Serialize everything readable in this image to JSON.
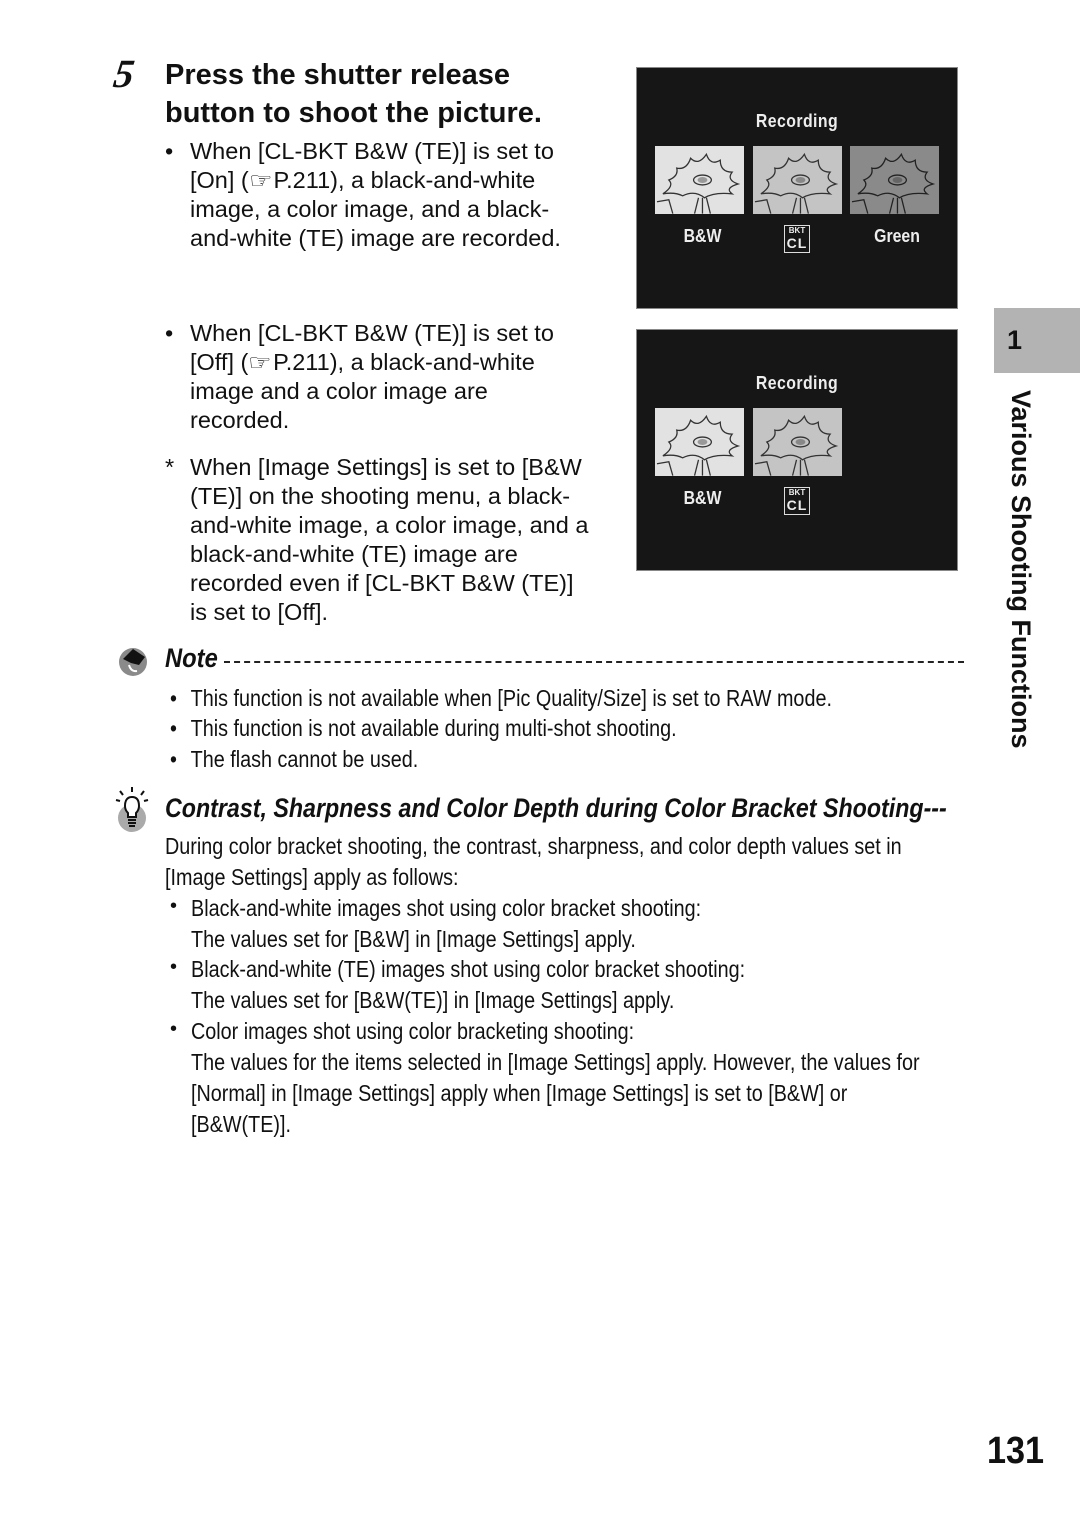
{
  "step": {
    "number": "5",
    "title_line1": "Press the shutter release",
    "title_line2": "button to shoot the picture."
  },
  "bullets": [
    {
      "mark": "•",
      "lines": [
        "When [CL-BKT B&W (TE)] is set to",
        "[On] (",
        "P.211), a black-and-white",
        "image, a color image, and a black-",
        "and-white (TE) image are recorded."
      ]
    },
    {
      "mark": "•",
      "lines": [
        "When [CL-BKT B&W (TE)] is set to",
        "[Off] (",
        "P.211), a black-and-white",
        "image and a color image are",
        "recorded."
      ]
    },
    {
      "mark": "*",
      "lines": [
        "When [Image Settings] is set to [B&W",
        "(TE)] on the shooting menu, a black-",
        "and-white image, a color image, and a",
        "black-and-white (TE) image are",
        "recorded even if [CL-BKT B&W (TE)]",
        "is set to [Off]."
      ]
    }
  ],
  "reference_icon": "pointing-hand-icon",
  "screens": [
    {
      "title": "Recording",
      "thumbnails": [
        "bw",
        "color",
        "green"
      ],
      "labels": {
        "left": "B&W",
        "badge_top": "BKT",
        "badge_bottom": "CL",
        "right": "Green"
      }
    },
    {
      "title": "Recording",
      "thumbnails": [
        "bw",
        "color"
      ],
      "labels": {
        "left": "B&W",
        "badge_top": "BKT",
        "badge_bottom": "CL"
      }
    }
  ],
  "sidebar": {
    "chapter_number": "1",
    "chapter_title": "Various Shooting Functions"
  },
  "note": {
    "heading": "Note",
    "items": [
      "This function is not available when [Pic Quality/Size] is set to RAW mode.",
      "This function is not available during multi-shot shooting.",
      "The flash cannot be used."
    ]
  },
  "tip": {
    "heading": "Contrast, Sharpness and Color Depth during Color Bracket Shooting---",
    "intro_line1": "During color bracket shooting, the contrast, sharpness, and color depth values set in",
    "intro_line2": "[Image Settings] apply as follows:",
    "items": [
      {
        "title": "Black-and-white images shot using color bracket shooting:",
        "body": [
          "The values set for [B&W] in [Image Settings] apply."
        ]
      },
      {
        "title": "Black-and-white (TE) images shot using color bracket shooting:",
        "body": [
          "The values set for [B&W(TE)] in [Image Settings] apply."
        ]
      },
      {
        "title": "Color images shot using color bracketing shooting:",
        "body": [
          "The values for the items selected in [Image Settings] apply. However, the values for",
          "[Normal] in [Image Settings] apply when [Image Settings] is set to [B&W] or",
          "[B&W(TE)]."
        ]
      }
    ]
  },
  "page_number": "131",
  "colors": {
    "screen_bg": "#161616",
    "side_tab_bg": "#b3b3b3",
    "thumb_bw": "#e2e2e2",
    "thumb_color": "#c4c4c4",
    "thumb_green": "#8a8a8a"
  }
}
